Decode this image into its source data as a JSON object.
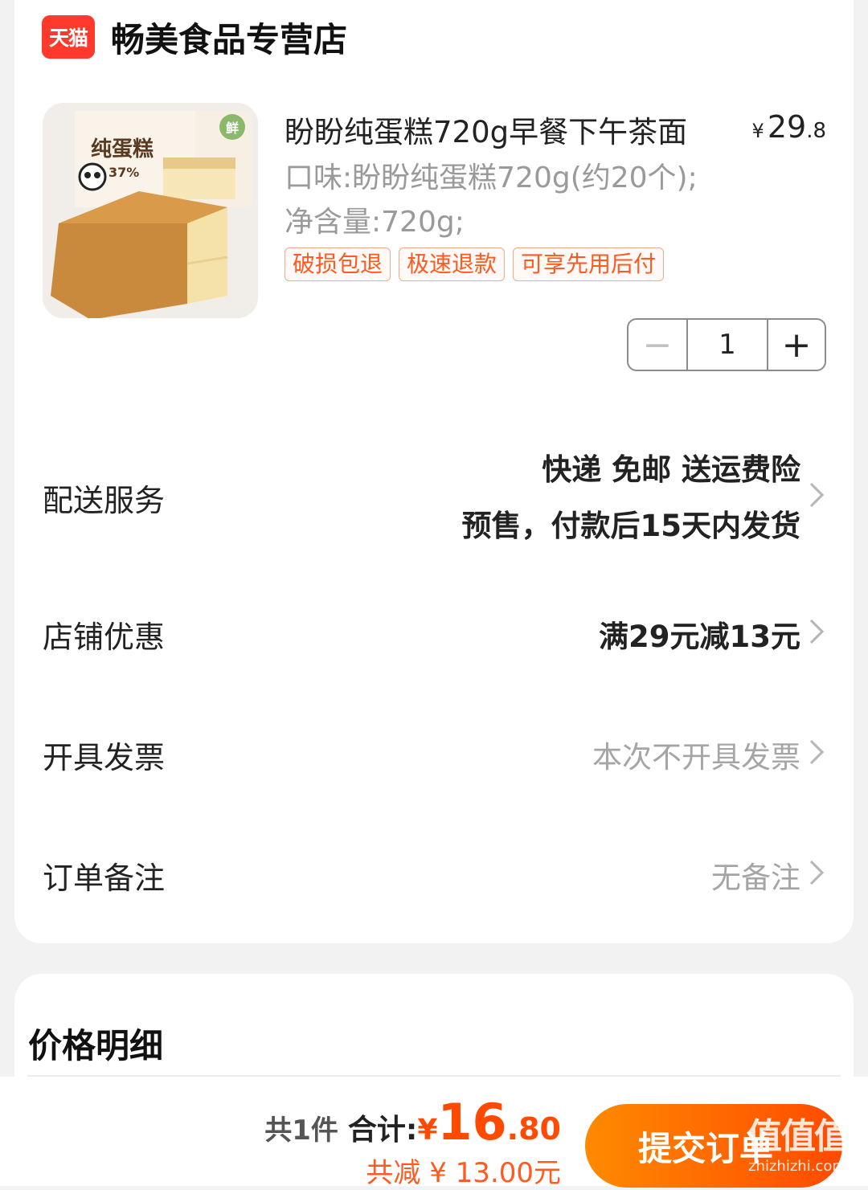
{
  "store": {
    "badge": "天猫",
    "name": "畅美食品专营店"
  },
  "product": {
    "title": "盼盼纯蛋糕720g早餐下午茶面",
    "price": {
      "currency": "¥",
      "integer": "29",
      "decimal": ".8"
    },
    "sku": "口味:盼盼纯蛋糕720g(约20个);净含量:720g;",
    "tags": [
      "破损包退",
      "极速退款",
      "可享先用后付"
    ],
    "quantity": "1",
    "image": {
      "box_label": "纯蛋糕",
      "percent": "37%",
      "fresh": "鲜"
    }
  },
  "rows": {
    "delivery": {
      "label": "配送服务",
      "line1": "快递 免邮 送运费险",
      "line2": "预售，付款后15天内发货"
    },
    "coupon": {
      "label": "店铺优惠",
      "value": "满29元减13元"
    },
    "invoice": {
      "label": "开具发票",
      "value": "本次不开具发票"
    },
    "remark": {
      "label": "订单备注",
      "value": "无备注"
    }
  },
  "price_detail": {
    "heading": "价格明细"
  },
  "footer": {
    "count": "共1件",
    "total_label": "合计:",
    "currency": "¥",
    "total_integer": "16",
    "total_decimal": ".80",
    "discount": "共减 ¥ 13.00元",
    "submit": "提交订单"
  },
  "watermark": {
    "glyph": "值值值",
    "site": "zhizhizhi.com"
  },
  "colors": {
    "accent": "#ff4a00",
    "tmall": "#ff3a2c",
    "tag_text": "#ff5a1f"
  }
}
